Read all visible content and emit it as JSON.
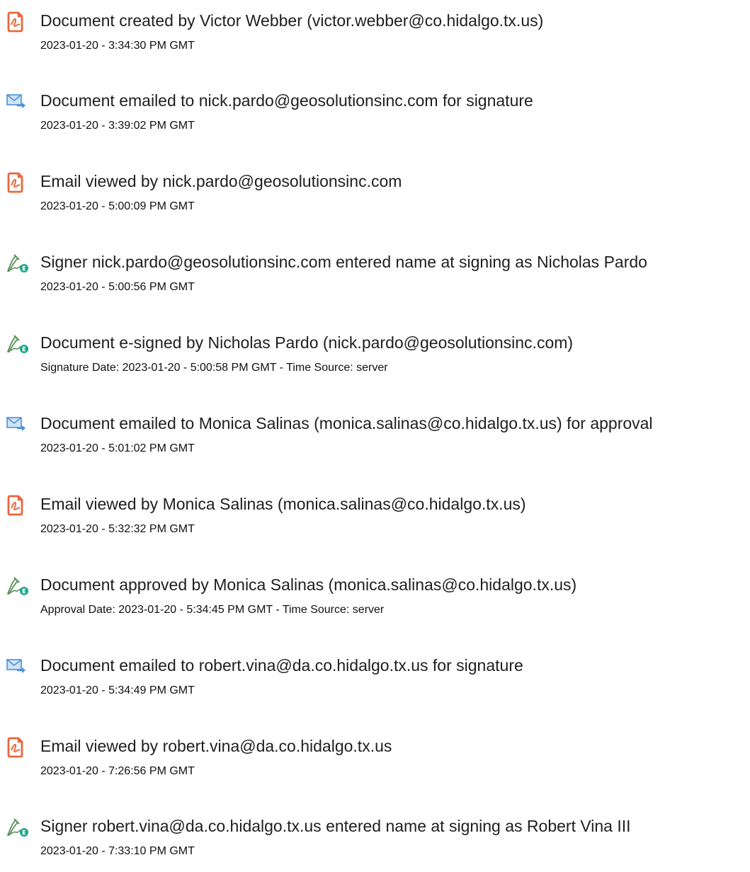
{
  "colors": {
    "doc_icon": "#e8663c",
    "mail_icon": "#4a90d9",
    "sign_icon": "#5a8f5a",
    "sign_badge": "#1aa78a"
  },
  "entries": [
    {
      "icon": "document-icon",
      "title": "Document created by Victor Webber (victor.webber@co.hidalgo.tx.us)",
      "sub": "2023-01-20 - 3:34:30 PM GMT"
    },
    {
      "icon": "email-send-icon",
      "title": "Document emailed to nick.pardo@geosolutionsinc.com for signature",
      "sub": "2023-01-20 - 3:39:02 PM GMT"
    },
    {
      "icon": "document-icon",
      "title": "Email viewed by nick.pardo@geosolutionsinc.com",
      "sub": "2023-01-20 - 5:00:09 PM GMT"
    },
    {
      "icon": "e-sign-pen-icon",
      "title": "Signer nick.pardo@geosolutionsinc.com entered name at signing as Nicholas Pardo",
      "sub": "2023-01-20 - 5:00:56 PM GMT"
    },
    {
      "icon": "e-sign-pen-icon",
      "title": "Document e-signed by Nicholas Pardo (nick.pardo@geosolutionsinc.com)",
      "sub": "Signature Date: 2023-01-20 - 5:00:58 PM GMT - Time Source: server"
    },
    {
      "icon": "email-send-icon",
      "title": "Document emailed to Monica Salinas (monica.salinas@co.hidalgo.tx.us) for approval",
      "sub": "2023-01-20 - 5:01:02 PM GMT"
    },
    {
      "icon": "document-icon",
      "title": "Email viewed by Monica Salinas (monica.salinas@co.hidalgo.tx.us)",
      "sub": "2023-01-20 - 5:32:32 PM GMT"
    },
    {
      "icon": "e-sign-pen-icon",
      "title": "Document approved by Monica Salinas (monica.salinas@co.hidalgo.tx.us)",
      "sub": "Approval Date: 2023-01-20 - 5:34:45 PM GMT - Time Source: server"
    },
    {
      "icon": "email-send-icon",
      "title": "Document emailed to robert.vina@da.co.hidalgo.tx.us for signature",
      "sub": "2023-01-20 - 5:34:49 PM GMT"
    },
    {
      "icon": "document-icon",
      "title": "Email viewed by robert.vina@da.co.hidalgo.tx.us",
      "sub": "2023-01-20 - 7:26:56 PM GMT"
    },
    {
      "icon": "e-sign-pen-icon",
      "title": "Signer robert.vina@da.co.hidalgo.tx.us entered name at signing as Robert Vina III",
      "sub": "2023-01-20 - 7:33:10 PM GMT"
    }
  ]
}
